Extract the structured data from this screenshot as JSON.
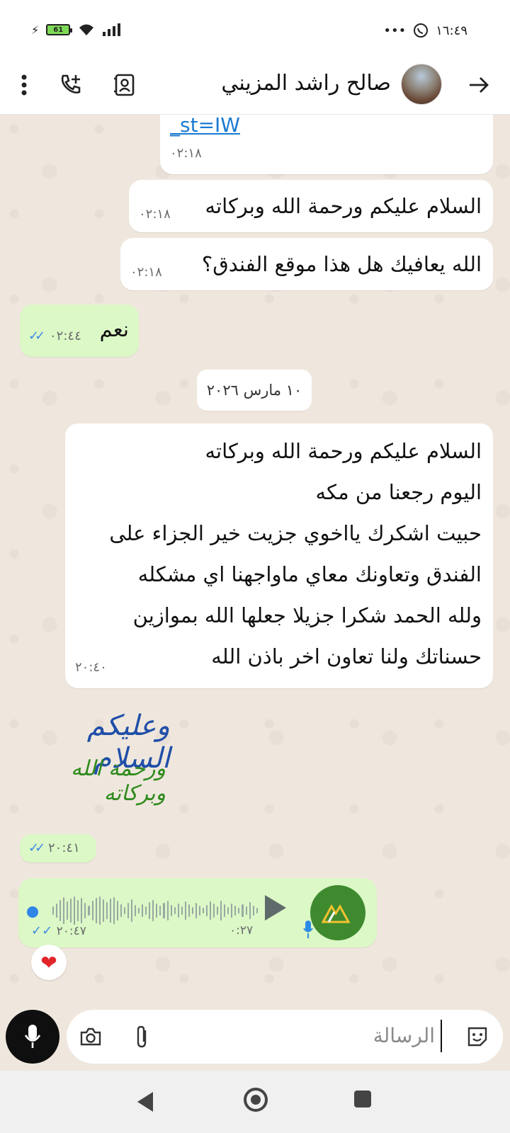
{
  "status_bar": {
    "time": "١٦:٤٩",
    "battery": "61",
    "dots": "•••"
  },
  "header": {
    "contact_name": "صالح راشد المزيني",
    "back_icon": "arrow-right-icon",
    "more_icon": "more-vert-icon",
    "call_add_icon": "add-call-icon",
    "contact_icon": "contact-card-icon"
  },
  "messages": [
    {
      "dir": "in",
      "link": "_st=IW",
      "time": "٠٢:١٨"
    },
    {
      "dir": "in",
      "text": "السلام عليكم ورحمة الله وبركاته",
      "time": "٠٢:١٨"
    },
    {
      "dir": "in",
      "text": "الله يعافيك هل هذا موقع الفندق؟",
      "time": "٠٢:١٨"
    },
    {
      "dir": "out",
      "text": "نعم",
      "time": "٠٢:٤٤"
    },
    {
      "dir": "in",
      "lines": [
        "السلام عليكم ورحمة الله وبركاته",
        "اليوم رجعنا من مكه",
        "حبيت اشكرك يااخوي جزيت خير الجزاء على",
        "الفندق وتعاونك معاي ماواجهنا اي مشكله",
        "ولله الحمد شكرا جزيلا جعلها الله بموازين",
        "حسناتك ولنا تعاون اخر باذن الله"
      ],
      "time": "٢٠:٤٠"
    },
    {
      "dir": "out",
      "sticker_line1": "وعليكم السلام",
      "sticker_line2": "ورحمة الله وبركاته",
      "time": "٢٠:٤١"
    },
    {
      "dir": "out",
      "type": "voice",
      "duration": "٠:٢٧",
      "time": "٢٠:٤٧",
      "reaction": "❤"
    }
  ],
  "date_chip": "١٠ مارس ٢٠٢٦",
  "input": {
    "placeholder": "الرسالة"
  },
  "colors": {
    "chat_bg": "#efe7dd",
    "outgoing": "#dbf8c6",
    "incoming": "#ffffff",
    "tick_blue": "#3f88e6"
  }
}
